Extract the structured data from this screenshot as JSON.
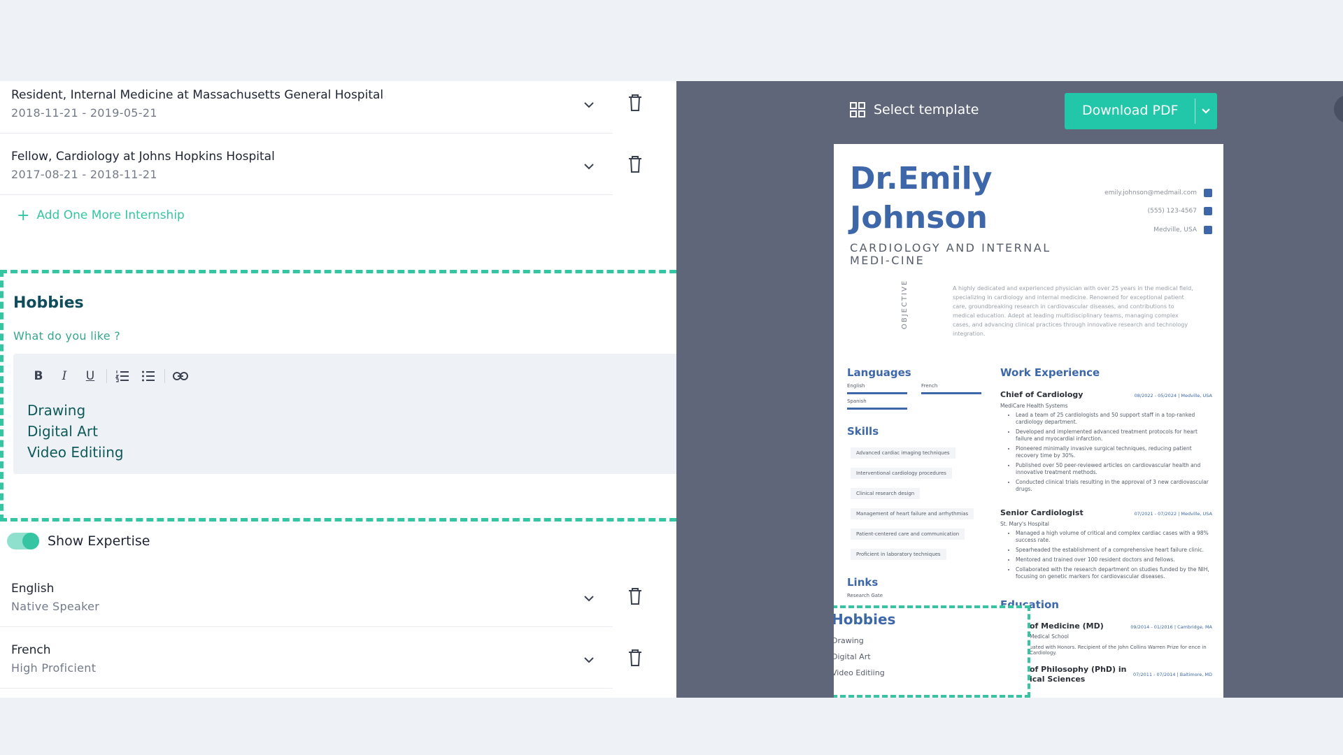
{
  "internships": [
    {
      "title": "Resident, Internal Medicine at Massachusetts General Hospital",
      "dates": "2018-11-21 - 2019-05-21"
    },
    {
      "title": "Fellow, Cardiology at Johns Hopkins Hospital",
      "dates": "2017-08-21 - 2018-11-21"
    }
  ],
  "add_internship_label": "Add One More Internship",
  "hobbies": {
    "heading": "Hobbies",
    "prompt": "What do you like ?",
    "toolbar": {
      "bold": "B",
      "italic": "I",
      "underline": "U"
    },
    "items": [
      "Drawing",
      "Digital Art",
      "Video Editiing"
    ]
  },
  "show_expertise_label": "Show Expertise",
  "languages": [
    {
      "name": "English",
      "level": "Native Speaker"
    },
    {
      "name": "French",
      "level": "High Proficient"
    }
  ],
  "preview": {
    "select_template_label": "Select template",
    "download_label": "Download PDF",
    "resume": {
      "name_line1": "Dr.Emily",
      "name_line2": "Johnson",
      "role": "CARDIOLOGY AND INTERNAL MEDI-CINE",
      "email": "emily.johnson@medmail.com",
      "phone": "(555) 123-4567",
      "location": "Medville, USA",
      "objective_label": "OBJECTIVE",
      "objective": "A highly dedicated and experienced physician with over 25 years in the medical field, specializing in cardiology and internal medicine. Renowned for exceptional patient care, groundbreaking research in cardiovascular diseases, and contributions to medical education. Adept at leading multidisciplinary teams, managing complex cases, and advancing clinical practices through innovative research and technology integration.",
      "languages_heading": "Languages",
      "lang_english": "English",
      "lang_french": "French",
      "lang_spanish": "Spanish",
      "skills_heading": "Skills",
      "skills": [
        "Advanced cardiac imaging techniques",
        "Interventional cardiology procedures",
        "Clinical research design",
        "Management of heart failure and arrhythmias",
        "Patient-centered care and communication",
        "Proficient in laboratory techniques"
      ],
      "links_heading": "Links",
      "link_1": "Research Gate",
      "work_heading": "Work Experience",
      "job1": {
        "title": "Chief of Cardiology",
        "org": "MediCare Health Systems",
        "date": "08/2022 - 05/2024 | Medville, USA",
        "bullets": [
          "Lead a team of 25 cardiologists and 50 support staff in a top-ranked cardiology department.",
          "Developed and implemented advanced treatment protocols for heart failure and myocardial infarction.",
          "Pioneered minimally invasive surgical techniques, reducing patient recovery time by 30%.",
          "Published over 50 peer-reviewed articles on cardiovascular health and innovative treatment methods.",
          "Conducted clinical trials resulting in the approval of 3 new cardiovascular drugs."
        ]
      },
      "job2": {
        "title": "Senior Cardiologist",
        "org": "St. Mary's Hospital",
        "date": "07/2021 - 07/2022 | Medville, USA",
        "bullets": [
          "Managed a high volume of critical and complex cardiac cases with a 98% success rate.",
          "Spearheaded the establishment of a comprehensive heart failure clinic.",
          "Mentored and trained over 100 resident doctors and fellows.",
          "Collaborated with the research department on studies funded by the NIH, focusing on genetic markers for cardiovascular diseases."
        ]
      },
      "education_heading": "Education",
      "edu1_title": "of Medicine (MD)",
      "edu1_school": "Medical School",
      "edu1_date": "09/2014 - 01/2016 | Cambridge, MA",
      "edu1_note": "uated with Honors. Recipient of the John Collins Warren Prize for ence in Cardiology.",
      "edu2_title": "of Philosophy (PhD) in",
      "edu2_title_2": "ical Sciences",
      "edu2_date": "07/2011 - 07/2014 | Baltimore, MD",
      "hobbies_heading": "Hobbies",
      "hobbies": [
        "Drawing",
        "Digital Art",
        "Video Editiing"
      ]
    }
  },
  "colors": {
    "accent": "#36c5a3",
    "resume_blue": "#3d67a8",
    "panel": "#5f667a",
    "download": "#21c7a8"
  }
}
